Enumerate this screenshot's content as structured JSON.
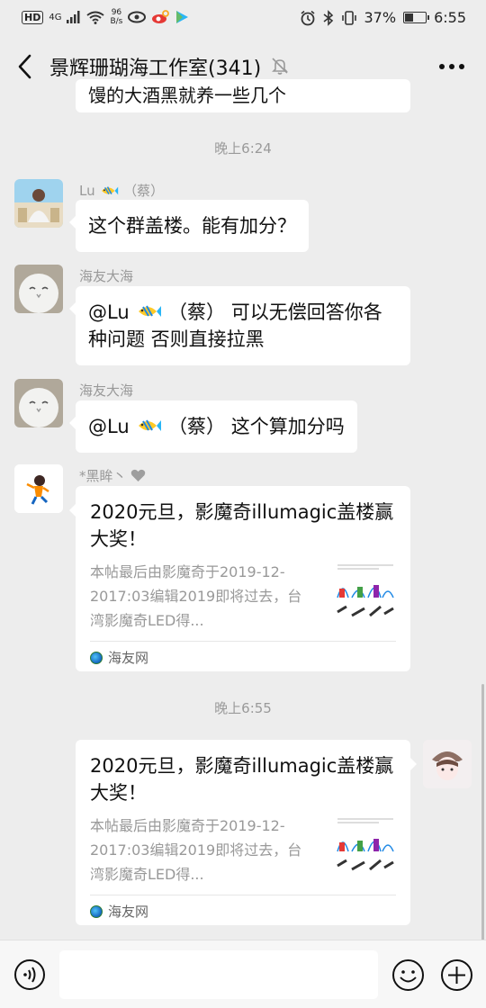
{
  "status_bar": {
    "hd": "HD",
    "signal": "4G",
    "speed_value": "96",
    "speed_unit": "B/s",
    "battery": "37%",
    "time": "6:55"
  },
  "header": {
    "title": "景辉珊瑚海工作室(341)",
    "back_icon": "chevron-left-icon",
    "mute_icon": "bell-off-icon",
    "more_icon": "more-dots-icon"
  },
  "messages": {
    "top_partial_text": "馒的大酒黑就养一些几个",
    "time1": "晚上6:24",
    "m1": {
      "sender_name": "Lu",
      "sender_suffix": "（蔡）",
      "text": "这个群盖楼。能有加分？"
    },
    "m2": {
      "sender_name": "海友大海",
      "at": "@Lu",
      "at_suffix": "（蔡）",
      "text_rest": "可以无偿回答你各种问题 否则直接拉黑"
    },
    "m3": {
      "sender_name": "海友大海",
      "at": "@Lu",
      "at_suffix": "（蔡）",
      "text_rest": "这个算加分吗"
    },
    "m4": {
      "sender_name": "*黑眸丶",
      "card_title": "2020元旦，影魔奇illumagic盖楼赢大奖！",
      "card_desc": "本帖最后由影魔奇于2019-12-2017:03编辑2019即将过去，台湾影魔奇LED得...",
      "card_source": "海友网"
    },
    "time2": "晚上6:55",
    "m5": {
      "card_title": "2020元旦，影魔奇illumagic盖楼赢大奖！",
      "card_desc": "本帖最后由影魔奇于2019-12-2017:03编辑2019即将过去，台湾影魔奇LED得...",
      "card_source": "海友网"
    }
  },
  "input_bar": {
    "voice_icon": "voice-icon",
    "emoji_icon": "emoji-icon",
    "plus_icon": "plus-circle-icon"
  },
  "colors": {
    "background": "#ededed",
    "bubble": "#ffffff",
    "meta_text": "#999999"
  }
}
